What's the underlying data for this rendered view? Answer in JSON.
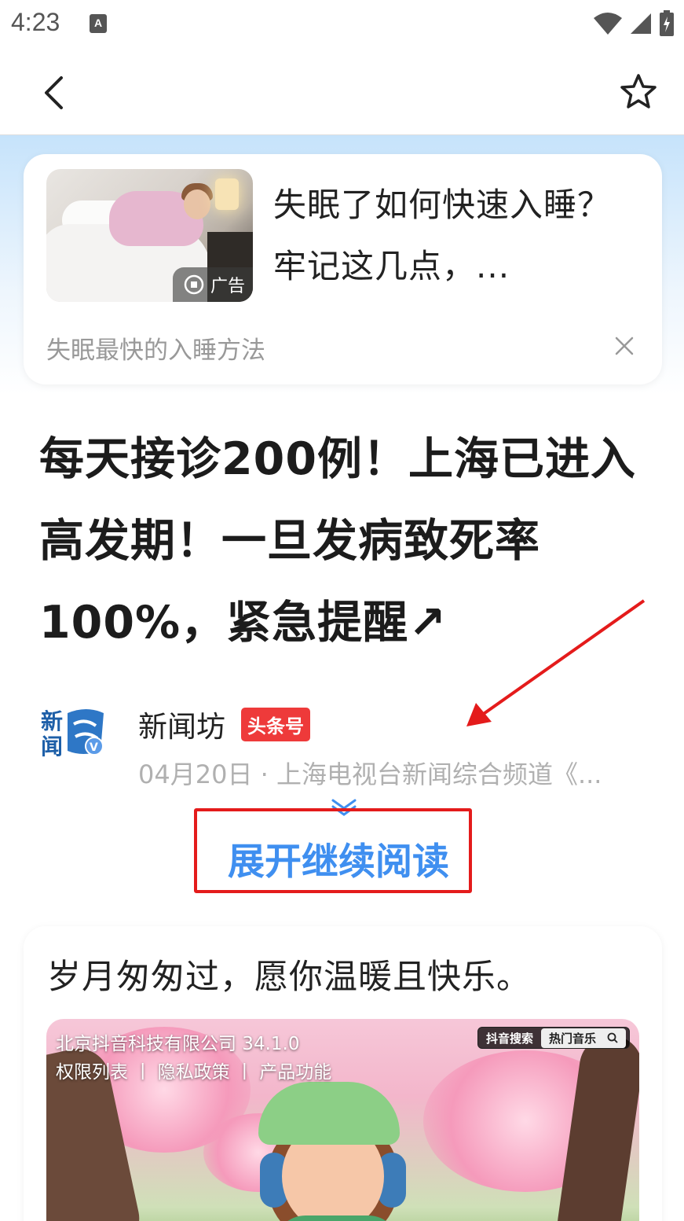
{
  "status_bar": {
    "time": "4:23",
    "notification_label": "A"
  },
  "ad": {
    "title": "失眠了如何快速入睡？牢记这几点，...",
    "badge_label": "广告",
    "subtitle": "失眠最快的入睡方法"
  },
  "article": {
    "headline": "每天接诊200例！上海已进入高发期！一旦发病致死率100%，紧急提醒↗",
    "author_name": "新闻坊",
    "author_badge": "头条号",
    "avatar_text": "新闻",
    "meta": "04月20日 · 上海电视台新闻综合频道《...",
    "expand_label": "展开继续阅读"
  },
  "post": {
    "text": "岁月匆匆过，愿你温暖且快乐。",
    "video_company": "北京抖音科技有限公司  34.1.0",
    "video_links": "权限列表 丨 隐私政策 丨 产品功能",
    "video_search_tag": "抖音搜索",
    "video_search_text": "热门音乐"
  },
  "colors": {
    "accent_blue": "#3f8ff0",
    "annotation_red": "#e41b1b",
    "badge_red": "#ee3a3a"
  }
}
